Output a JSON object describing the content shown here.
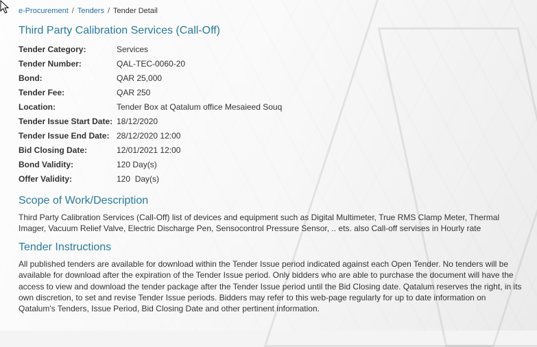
{
  "breadcrumb": {
    "items": [
      "e-Procurement",
      "Tenders"
    ],
    "current": "Tender Detail",
    "separator": "/"
  },
  "title": "Third Party Calibration Services (Call-Off)",
  "details": [
    {
      "label": "Tender Category:",
      "value": "Services"
    },
    {
      "label": "Tender Number:",
      "value": "QAL-TEC-0060-20"
    },
    {
      "label": "Bond:",
      "value": "QAR 25,000"
    },
    {
      "label": "Tender Fee:",
      "value": "QAR 250"
    },
    {
      "label": "Location:",
      "value": "Tender Box at Qatalum office Mesaieed Souq"
    },
    {
      "label": "Tender Issue Start Date:",
      "value": "18/12/2020"
    },
    {
      "label": "Tender Issue End Date:",
      "value": "28/12/2020 12:00"
    },
    {
      "label": "Bid Closing Date:",
      "value": "12/01/2021 12:00"
    },
    {
      "label": "Bond Validity:",
      "value": "120 Day(s)"
    },
    {
      "label": "Offer Validity:",
      "value": "120  Day(s)"
    }
  ],
  "scope": {
    "heading": "Scope of Work/Description",
    "text": "Third Party Calibration Services (Call-Off) list of devices and equipment such as Digital Multimeter, True RMS Clamp Meter, Thermal Imager, Vacuum Relief Valve, Electric Discharge Pen, Sensocontrol Pressure Sensor, .. ets. also Call-off servises in Hourly rate"
  },
  "instructions": {
    "heading": "Tender Instructions",
    "text": "All published tenders are available for download within the Tender Issue period indicated against each Open Tender. No tenders will be available for download after the expiration of the Tender Issue period. Only bidders who are able to purchase the document will have the access to view and download the tender package after the Tender Issue period until the Bid Closing date. Qatalum reserves the right, in its own discretion, to set and revise Tender Issue periods. Bidders may refer to this web-page regularly for up to date information on Qatalum's Tenders, Issue Period, Bid Closing Date and other pertinent information."
  },
  "colors": {
    "heading": "#2b7a9b",
    "link": "#2a6fa6",
    "text": "#333333"
  },
  "icons": {
    "cursor": "mouse-pointer-icon"
  }
}
